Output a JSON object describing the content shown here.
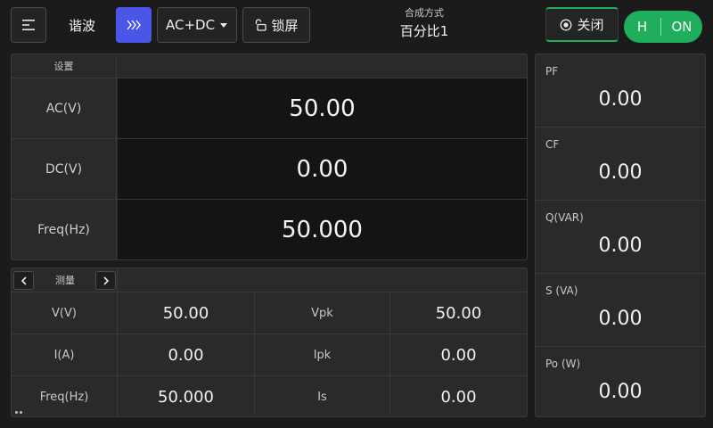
{
  "topbar": {
    "menu_icon": "menu-icon",
    "title": "谐波",
    "next_icon": "triple-chevron-right-icon",
    "mode_value": "AC+DC",
    "lock_icon": "unlock-icon",
    "lock_label": "锁屏",
    "synthesis_label": "合成方式",
    "synthesis_value": "百分比1",
    "close_icon": "record-icon",
    "close_label": "关闭",
    "output_range": "H",
    "output_state": "ON",
    "accent_color": "#4a56e8",
    "on_color": "#1fae5b"
  },
  "settings": {
    "header": "设置",
    "rows": [
      {
        "label": "AC(V)",
        "value": "50.00"
      },
      {
        "label": "DC(V)",
        "value": "0.00"
      },
      {
        "label": "Freq(Hz)",
        "value": "50.000"
      }
    ]
  },
  "measure": {
    "header": "测量",
    "rows": [
      {
        "label1": "V(V)",
        "value1": "50.00",
        "label2": "Vpk",
        "value2": "50.00"
      },
      {
        "label1": "I(A)",
        "value1": "0.00",
        "label2": "Ipk",
        "value2": "0.00"
      },
      {
        "label1": "Freq(Hz)",
        "value1": "50.000",
        "label2": "Is",
        "value2": "0.00"
      }
    ]
  },
  "side": {
    "items": [
      {
        "label": "PF",
        "value": "0.00"
      },
      {
        "label": "CF",
        "value": "0.00"
      },
      {
        "label": "Q(VAR)",
        "value": "0.00"
      },
      {
        "label": "S (VA)",
        "value": "0.00"
      },
      {
        "label": "Po (W)",
        "value": "0.00"
      }
    ]
  }
}
